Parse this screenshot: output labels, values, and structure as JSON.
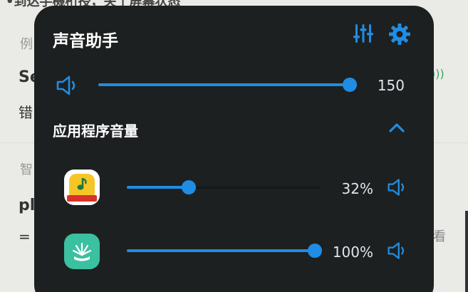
{
  "background": {
    "fragments": [
      "•到达手機桁授，关了屏幕状态",
      "例",
      "Se",
      "错",
      "智",
      "pl",
      "=",
      "看",
      ")))"
    ]
  },
  "panel": {
    "title": "声音助手",
    "header_icons": [
      "equalizer-icon",
      "gear-icon"
    ],
    "master_volume": {
      "icon": "speaker-icon",
      "value": 150,
      "max": 150,
      "label": "150"
    },
    "apps_section": {
      "title": "应用程序音量",
      "expanded": true,
      "toggle_icon": "chevron-up-icon"
    },
    "apps": [
      {
        "icon": "qq-music-icon",
        "percent": 32,
        "label": "32%",
        "mute_icon": "speaker-icon"
      },
      {
        "icon": "green-app-icon",
        "percent": 100,
        "label": "100%",
        "mute_icon": "speaker-icon"
      }
    ]
  },
  "colors": {
    "panel_bg": "#1d2020",
    "accent": "#1f8de4",
    "text": "#ffffff",
    "value_text": "#dde6ee"
  }
}
